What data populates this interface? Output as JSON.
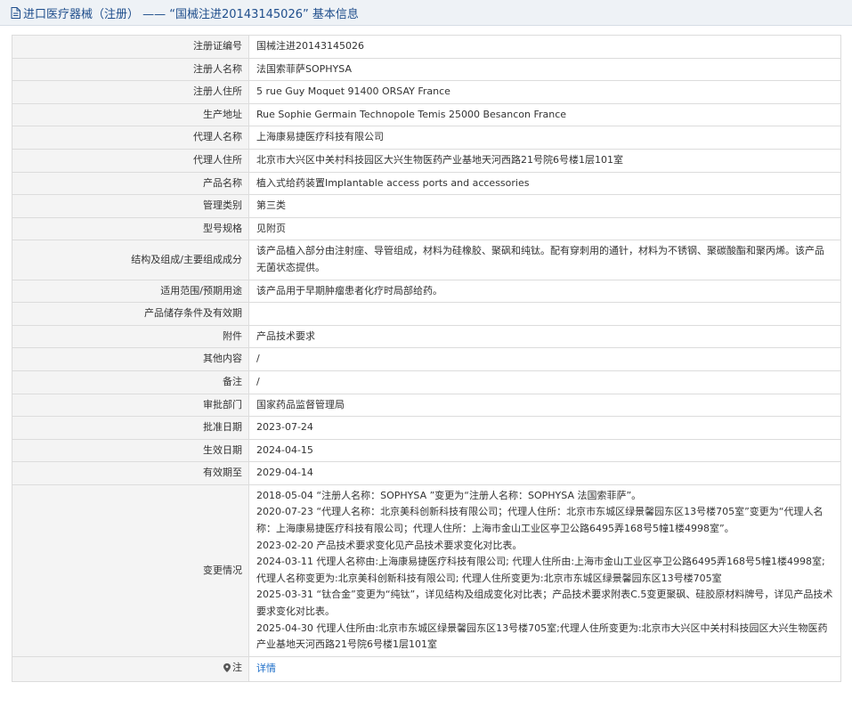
{
  "header": {
    "title": "进口医疗器械（注册） —— “国械注进20143145026” 基本信息"
  },
  "rows": [
    {
      "label": "注册证编号",
      "value": "国械注进20143145026"
    },
    {
      "label": "注册人名称",
      "value": "法国索菲萨SOPHYSA"
    },
    {
      "label": "注册人住所",
      "value": "5 rue Guy Moquet 91400 ORSAY France"
    },
    {
      "label": "生产地址",
      "value": "Rue Sophie Germain Technopole Temis 25000 Besancon France"
    },
    {
      "label": "代理人名称",
      "value": "上海康易捷医疗科技有限公司"
    },
    {
      "label": "代理人住所",
      "value": "北京市大兴区中关村科技园区大兴生物医药产业基地天河西路21号院6号楼1层101室"
    },
    {
      "label": "产品名称",
      "value": "植入式给药装置Implantable access ports and accessories"
    },
    {
      "label": "管理类别",
      "value": "第三类"
    },
    {
      "label": "型号规格",
      "value": "见附页"
    },
    {
      "label": "结构及组成/主要组成成分",
      "value": "该产品植入部分由注射座、导管组成，材料为硅橡胶、聚砜和纯钛。配有穿刺用的通针，材料为不锈钢、聚碳酸酯和聚丙烯。该产品无菌状态提供。"
    },
    {
      "label": "适用范围/预期用途",
      "value": "该产品用于早期肿瘤患者化疗时局部给药。"
    },
    {
      "label": "产品储存条件及有效期",
      "value": ""
    },
    {
      "label": "附件",
      "value": "产品技术要求"
    },
    {
      "label": "其他内容",
      "value": "/"
    },
    {
      "label": "备注",
      "value": "/"
    },
    {
      "label": "审批部门",
      "value": "国家药品监督管理局"
    },
    {
      "label": "批准日期",
      "value": "2023-07-24"
    },
    {
      "label": "生效日期",
      "value": "2024-04-15"
    },
    {
      "label": "有效期至",
      "value": "2029-04-14"
    }
  ],
  "changes": {
    "label": "变更情况",
    "items": [
      "2018-05-04 “注册人名称：SOPHYSA ”变更为“注册人名称：SOPHYSA 法国索菲萨”。",
      "2020-07-23 “代理人名称：北京美科创新科技有限公司；代理人住所：北京市东城区绿景馨园东区13号楼705室”变更为“代理人名称：上海康易捷医疗科技有限公司；代理人住所：上海市金山工业区亭卫公路6495弄168号5幢1楼4998室”。",
      "2023-02-20 产品技术要求变化见产品技术要求变化对比表。",
      "2024-03-11 代理人名称由:上海康易捷医疗科技有限公司; 代理人住所由:上海市金山工业区亭卫公路6495弄168号5幢1楼4998室;代理人名称变更为:北京美科创新科技有限公司; 代理人住所变更为:北京市东城区绿景馨园东区13号楼705室",
      "2025-03-31 “钛合金”变更为“纯钛”，详见结构及组成变化对比表；产品技术要求附表C.5变更聚砜、硅胶原材料牌号，详见产品技术要求变化对比表。",
      "2025-04-30 代理人住所由:北京市东城区绿景馨园东区13号楼705室;代理人住所变更为:北京市大兴区中关村科技园区大兴生物医药产业基地天河西路21号院6号楼1层101室"
    ]
  },
  "note": {
    "label": "注",
    "icon": "map-pin-icon",
    "link": "详情"
  }
}
